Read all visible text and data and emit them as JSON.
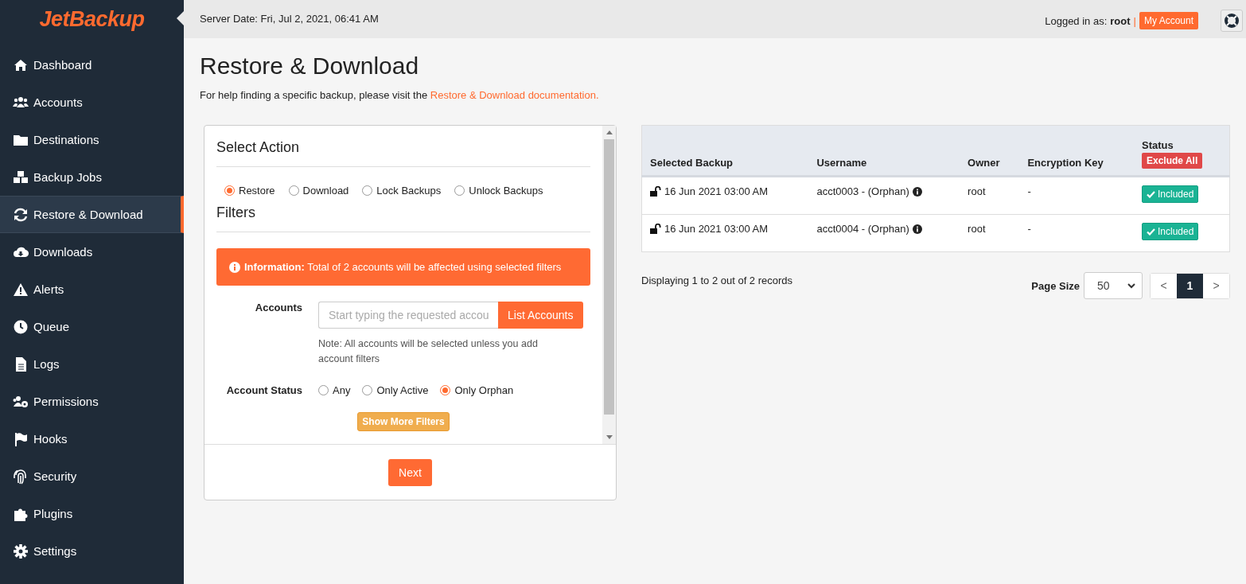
{
  "logo": "JetBackup",
  "header": {
    "server_date": "Server Date: Fri, Jul 2, 2021, 06:41 AM",
    "logged_in_label": "Logged in as:",
    "user": "root",
    "separator": "|",
    "account_button": "My Account"
  },
  "sidebar": {
    "items": [
      {
        "label": "Dashboard",
        "selected": false
      },
      {
        "label": "Accounts",
        "selected": false
      },
      {
        "label": "Destinations",
        "selected": false
      },
      {
        "label": "Backup Jobs",
        "selected": false
      },
      {
        "label": "Restore & Download",
        "selected": true
      },
      {
        "label": "Downloads",
        "selected": false
      },
      {
        "label": "Alerts",
        "selected": false
      },
      {
        "label": "Queue",
        "selected": false
      },
      {
        "label": "Logs",
        "selected": false
      },
      {
        "label": "Permissions",
        "selected": false
      },
      {
        "label": "Hooks",
        "selected": false
      },
      {
        "label": "Security",
        "selected": false
      },
      {
        "label": "Plugins",
        "selected": false
      },
      {
        "label": "Settings",
        "selected": false
      }
    ]
  },
  "page": {
    "title": "Restore & Download",
    "help_text": "For help finding a specific backup, please visit the",
    "help_link": "Restore & Download documentation."
  },
  "action_panel": {
    "select_action_title": "Select Action",
    "actions": [
      {
        "label": "Restore",
        "selected": true
      },
      {
        "label": "Download",
        "selected": false
      },
      {
        "label": "Lock Backups",
        "selected": false
      },
      {
        "label": "Unlock Backups",
        "selected": false
      }
    ],
    "filters_title": "Filters",
    "info": "**Information:** Total of 2 accounts will be affected using selected filters",
    "accounts_label": "Accounts",
    "accounts_placeholder": "Start typing the requested accou",
    "list_button": "List Accounts",
    "note": "Note: All accounts will be selected unless you add account filters",
    "status_label": "Account Status",
    "statuses": [
      {
        "label": "Any",
        "selected": false
      },
      {
        "label": "Only Active",
        "selected": false
      },
      {
        "label": "Only Orphan",
        "selected": true
      }
    ],
    "more_filters_button": "Show More Filters",
    "next_button": "Next"
  },
  "backups_table": {
    "columns": [
      "Selected Backup",
      "Username",
      "Owner",
      "Encryption Key",
      "Status"
    ],
    "exclude_all_button": "Exclude All",
    "rows": [
      {
        "backup": "16 Jun 2021 03:00 AM",
        "locked": false,
        "username": "acct0003 - (Orphan)",
        "owner": "root",
        "encryption_key": "-",
        "status": "Included"
      },
      {
        "backup": "16 Jun 2021 03:00 AM",
        "locked": false,
        "username": "acct0004 - (Orphan)",
        "owner": "root",
        "encryption_key": "-",
        "status": "Included"
      }
    ]
  },
  "records_text": "Displaying 1 to 2 out of 2 records",
  "pagination": {
    "page_size_label": "Page Size",
    "page_size": "50",
    "prev": "<",
    "pages": [
      {
        "label": "1",
        "selected": true
      }
    ],
    "next": ">"
  }
}
